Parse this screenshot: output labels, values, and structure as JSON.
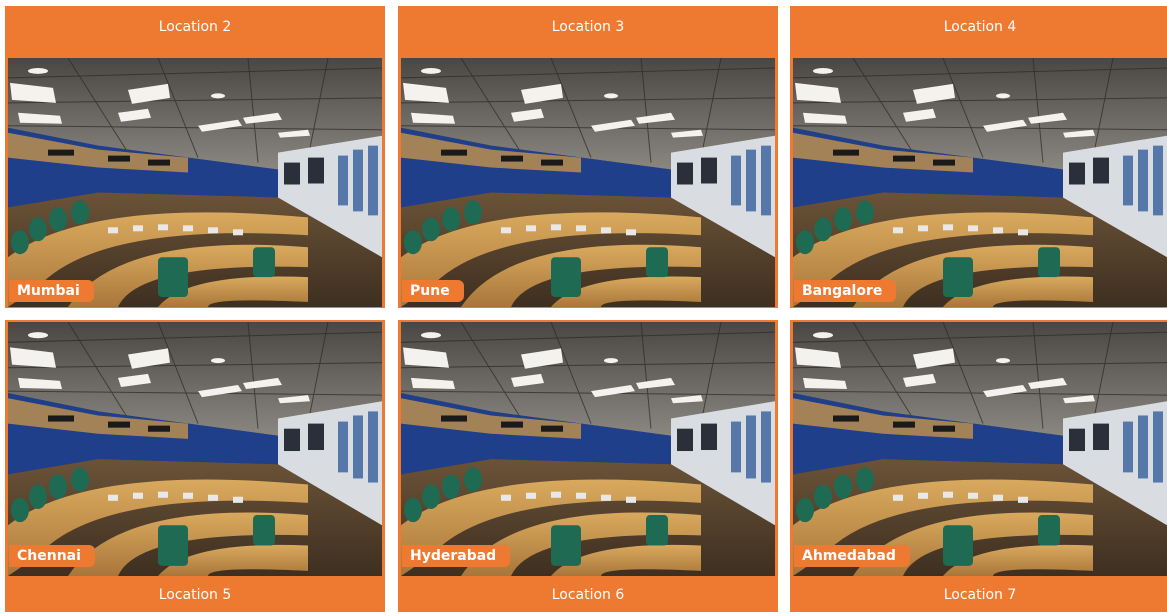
{
  "locations": [
    {
      "header": "Location 2",
      "city": "Mumbai"
    },
    {
      "header": "Location 3",
      "city": "Pune"
    },
    {
      "header": "Location 4",
      "city": "Bangalore"
    },
    {
      "header": "Location 5",
      "city": "Chennai"
    },
    {
      "header": "Location 6",
      "city": "Hyderabad"
    },
    {
      "header": "Location 7",
      "city": "Ahmedabad"
    }
  ],
  "colors": {
    "accent": "#ee7a31"
  }
}
